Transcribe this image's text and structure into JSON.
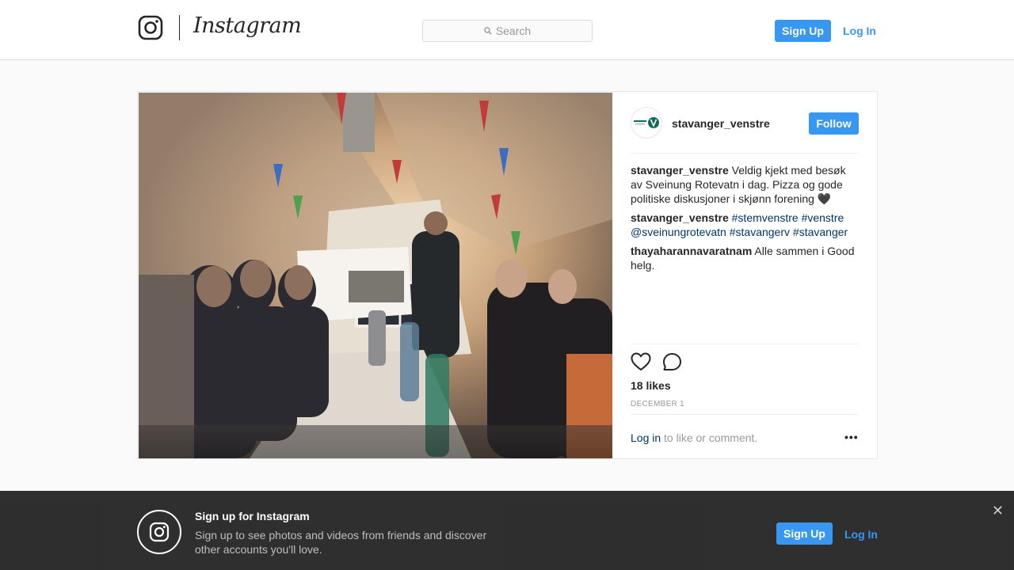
{
  "header": {
    "wordmark": "Instagram",
    "search_placeholder": "Search",
    "signup_label": "Sign Up",
    "login_label": "Log In"
  },
  "post": {
    "username": "stavanger_venstre",
    "follow_label": "Follow",
    "avatar_text": "VENSTRE",
    "comments": [
      {
        "user": "stavanger_venstre",
        "text": "Veldig kjekt med besøk av Sveinung Rotevatn i dag. Pizza og gode politiske diskusjoner i skjønn forening 🖤"
      },
      {
        "user": "stavanger_venstre",
        "tags": [
          "#stemvenstre",
          "#venstre",
          "@sveinungrotevatn",
          "#stavangerv",
          "#stavanger"
        ]
      },
      {
        "user": "thayaharannavaratnam",
        "text": "Alle sammen i Good helg."
      }
    ],
    "likes": "18 likes",
    "date": "DECEMBER 1",
    "login_link": "Log in",
    "login_rest": "to like or comment.",
    "more_label": "•••"
  },
  "banner": {
    "title": "Sign up for Instagram",
    "text": "Sign up to see photos and videos from friends and discover other accounts you'll love.",
    "signup_label": "Sign Up",
    "login_label": "Log In",
    "close_label": "✕"
  },
  "icons": {
    "logo": "instagram-glyph-icon",
    "search": "search-icon",
    "like": "heart-icon",
    "comment": "comment-icon",
    "close": "close-icon"
  },
  "colors": {
    "accent": "#3897f0",
    "link": "#003569"
  }
}
